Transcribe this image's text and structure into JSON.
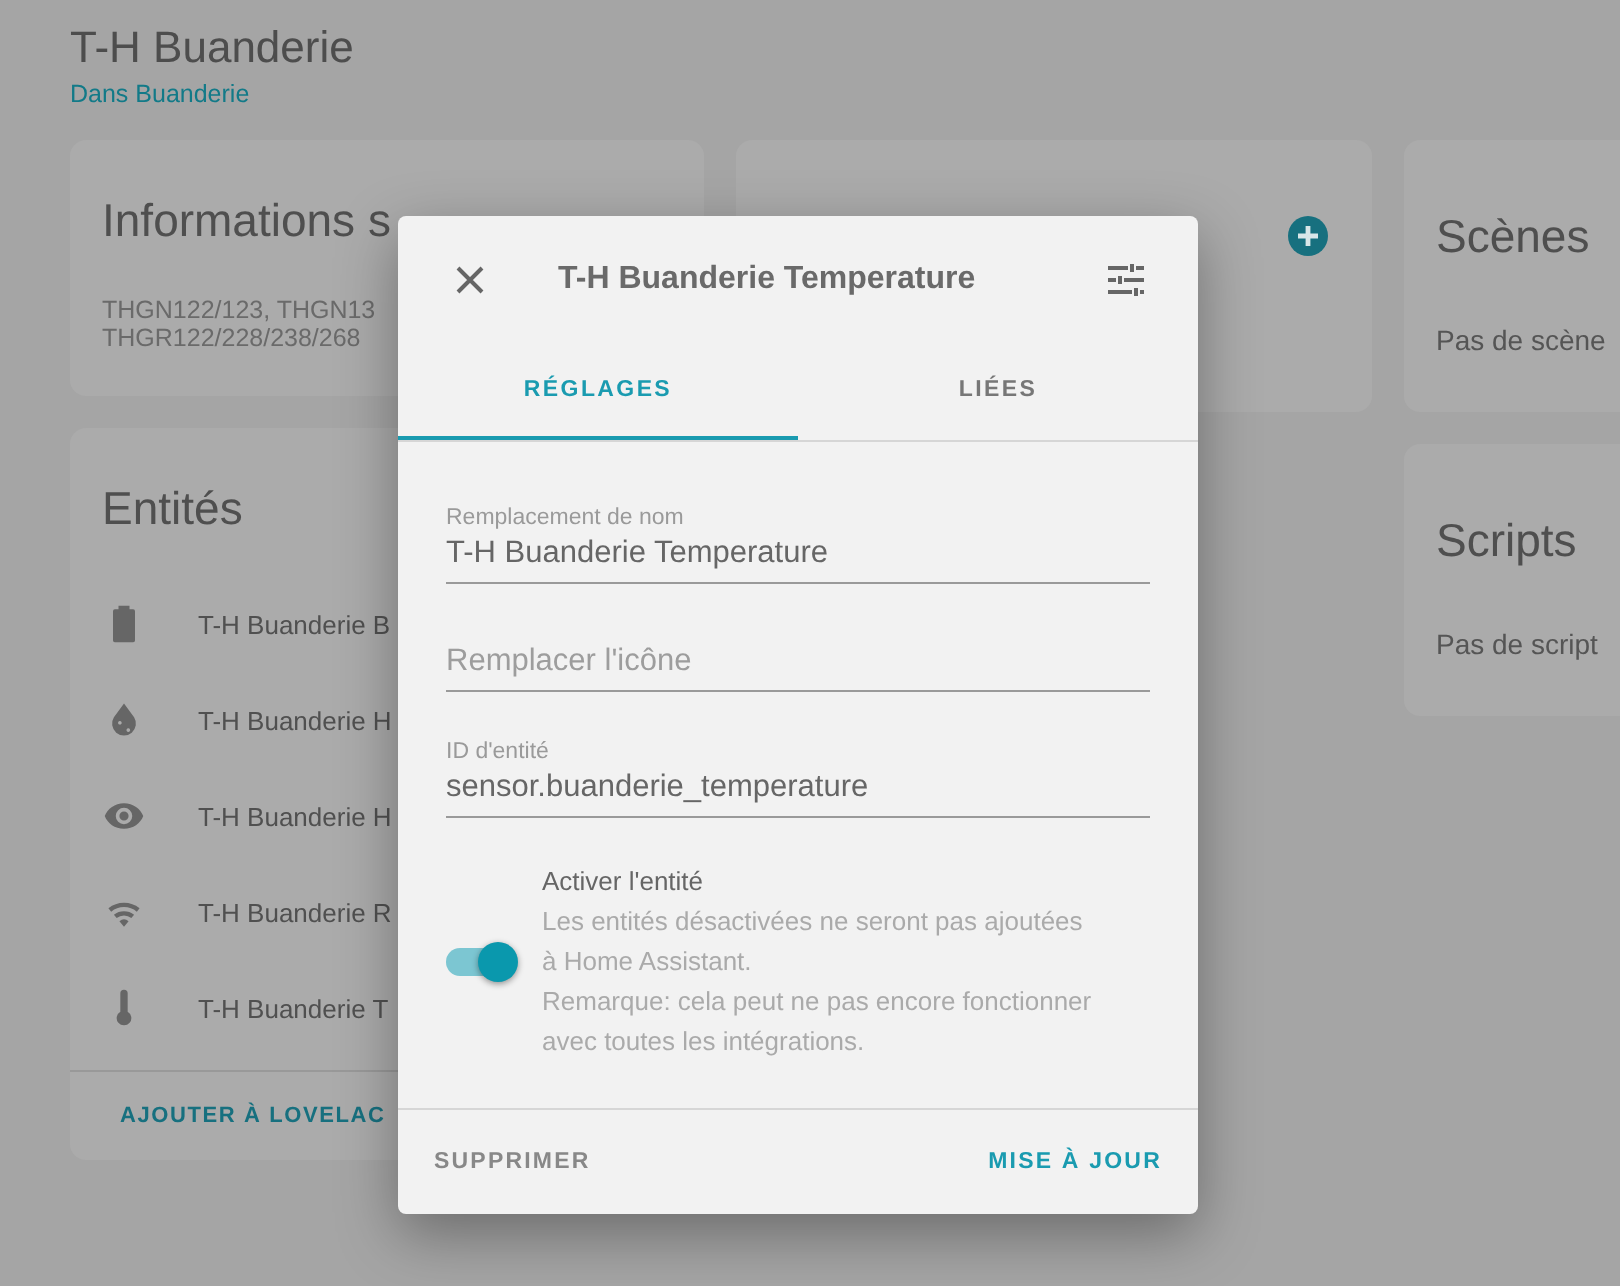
{
  "header": {
    "title": "T-H Buanderie",
    "area_link": "Dans Buanderie"
  },
  "device_info": {
    "title": "Informations s",
    "lines": [
      "THGN122/123, THGN13",
      "THGR122/228/238/268"
    ]
  },
  "entities": {
    "title": "Entités",
    "items": [
      {
        "kind": "battery",
        "name": "T-H Buanderie B"
      },
      {
        "kind": "humidity",
        "name": "T-H Buanderie H"
      },
      {
        "kind": "eye",
        "name": "T-H Buanderie H"
      },
      {
        "kind": "signal",
        "name": "T-H Buanderie R"
      },
      {
        "kind": "thermometer",
        "name": "T-H Buanderie T"
      }
    ],
    "action": "AJOUTER À LOVELAC"
  },
  "scenes": {
    "title": "Scènes",
    "empty": "Pas de scène"
  },
  "scripts": {
    "title": "Scripts",
    "empty": "Pas de script"
  },
  "dialog": {
    "title": "T-H Buanderie Temperature",
    "tabs": [
      {
        "label": "RÉGLAGES",
        "selected": true
      },
      {
        "label": "LIÉES",
        "selected": false
      }
    ],
    "fields": [
      {
        "label": "Remplacement de nom",
        "value": "T-H Buanderie Temperature"
      },
      {
        "placeholder": "Remplacer l'icône"
      },
      {
        "label": "ID d'entité",
        "value": "sensor.buanderie_temperature"
      }
    ],
    "enable": {
      "on": true,
      "label": "Activer l'entité",
      "description": "Les entités désactivées ne seront pas ajoutées à Home Assistant.",
      "note": "Remarque: cela peut ne pas encore fonctionner avec toutes les intégrations."
    },
    "delete_button": "SUPPRIMER",
    "update_button": "MISE À JOUR"
  }
}
